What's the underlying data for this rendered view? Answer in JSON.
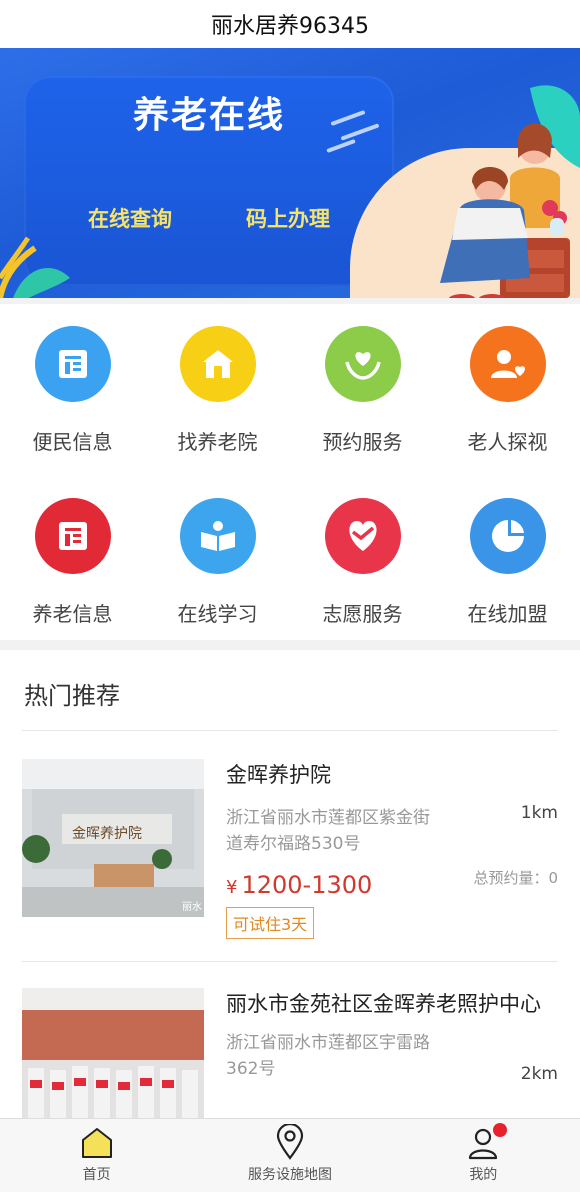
{
  "header": {
    "title": "丽水居养96345"
  },
  "banner": {
    "title": "养老在线",
    "sub_left": "在线查询",
    "sub_right": "码上办理",
    "pager": "1 of 1"
  },
  "services": [
    {
      "label": "便民信息",
      "icon": "document-icon",
      "color": "#3aa2f0"
    },
    {
      "label": "找养老院",
      "icon": "house-icon",
      "color": "#f7cf14"
    },
    {
      "label": "预约服务",
      "icon": "heart-hands-icon",
      "color": "#8ccc49"
    },
    {
      "label": "老人探视",
      "icon": "person-heart-icon",
      "color": "#f5731d"
    },
    {
      "label": "养老信息",
      "icon": "document-icon",
      "color": "#e22a36"
    },
    {
      "label": "在线学习",
      "icon": "reading-icon",
      "color": "#3da5ee"
    },
    {
      "label": "志愿服务",
      "icon": "heart-icon",
      "color": "#e8354a"
    },
    {
      "label": "在线加盟",
      "icon": "pie-icon",
      "color": "#3a94e8"
    }
  ],
  "recommend": {
    "title": "热门推荐",
    "items": [
      {
        "name": "金晖养护院",
        "address": "浙江省丽水市莲都区紫金街道寿尔福路530号",
        "distance": "1km",
        "currency": "¥",
        "price": "1200-1300",
        "count": "总预约量：0",
        "trial": "可试住3天",
        "thumb_sign": "金晖养护院",
        "watermark": "丽水"
      },
      {
        "name": "丽水市金苑社区金晖养老照护中心",
        "address": "浙江省丽水市莲都区宇雷路362号",
        "distance": "2km"
      }
    ]
  },
  "tabbar": {
    "home": "首页",
    "map": "服务设施地图",
    "mine": "我的"
  },
  "colors": {
    "accent_price": "#d0392b",
    "tab_active": "#f5e05a",
    "badge": "#e8222d"
  }
}
